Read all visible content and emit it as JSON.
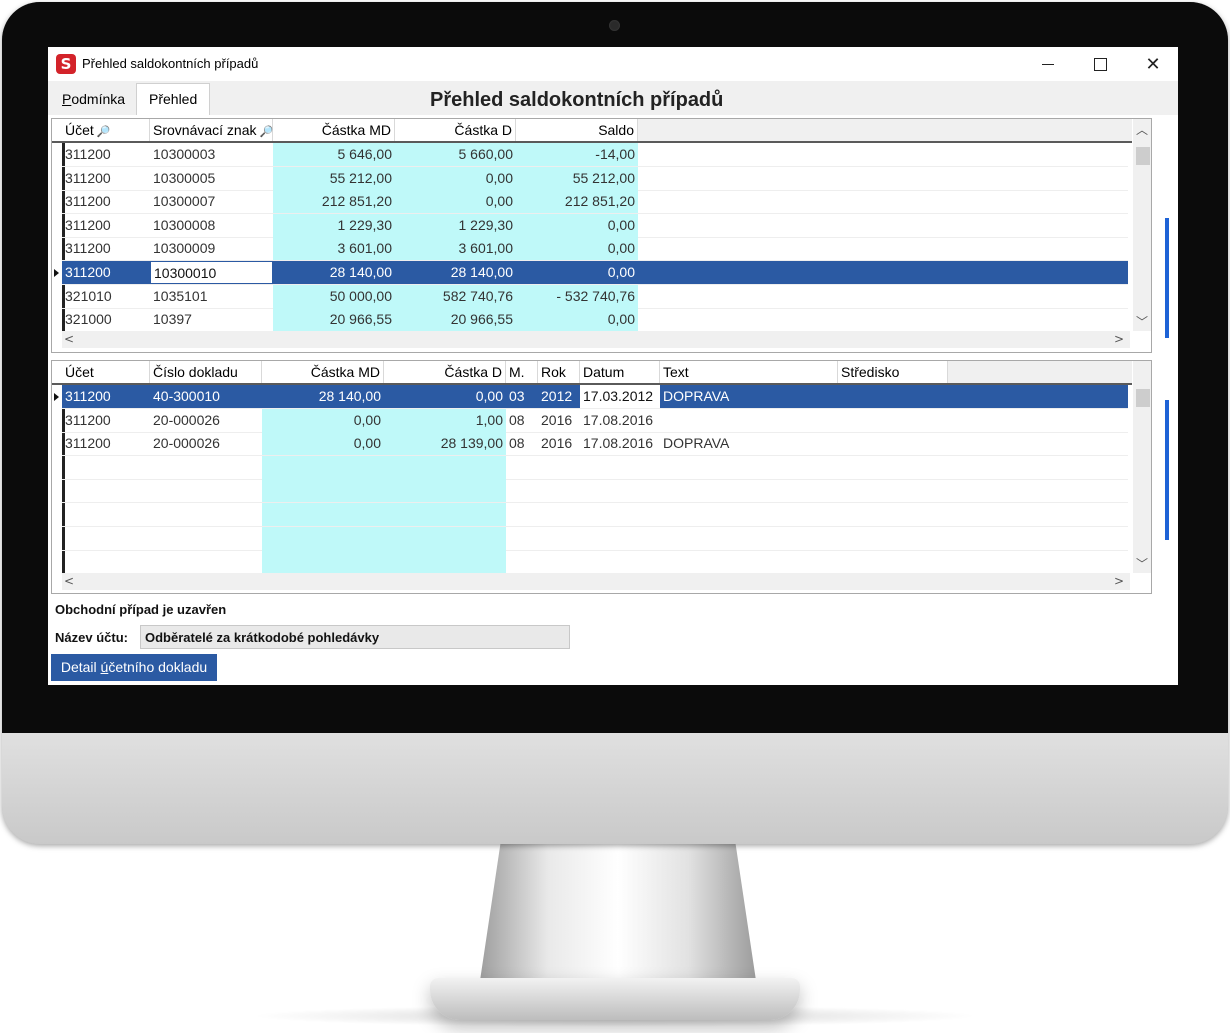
{
  "window": {
    "title": "Přehled saldokontních případů"
  },
  "tabs": [
    {
      "label": "Podmínka"
    },
    {
      "label": "Přehled"
    }
  ],
  "heading": "Přehled saldokontních případů",
  "top_grid": {
    "columns": [
      "Účet",
      "Srovnávací znak",
      "Částka MD",
      "Částka D",
      "Saldo"
    ],
    "rows": [
      [
        "311200",
        "10300003",
        "5 646,00",
        "5 660,00",
        "-14,00"
      ],
      [
        "311200",
        "10300005",
        "55 212,00",
        "0,00",
        "55 212,00"
      ],
      [
        "311200",
        "10300007",
        "212 851,20",
        "0,00",
        "212 851,20"
      ],
      [
        "311200",
        "10300008",
        "1 229,30",
        "1 229,30",
        "0,00"
      ],
      [
        "311200",
        "10300009",
        "3 601,00",
        "3 601,00",
        "0,00"
      ],
      [
        "311200",
        "10300010",
        "28 140,00",
        "28 140,00",
        "0,00"
      ],
      [
        "321010",
        "1035101",
        "50 000,00",
        "582 740,76",
        "- 532 740,76"
      ],
      [
        "321000",
        "10397",
        "20 966,55",
        "20 966,55",
        "0,00"
      ]
    ],
    "selected_row": 5
  },
  "bottom_grid": {
    "columns": [
      "Účet",
      "Číslo dokladu",
      "Částka MD",
      "Částka D",
      "M.",
      "Rok",
      "Datum",
      "Text",
      "Středisko"
    ],
    "rows": [
      [
        "311200",
        "40-300010",
        "28 140,00",
        "0,00",
        "03",
        "2012",
        "17.03.2012",
        "DOPRAVA",
        ""
      ],
      [
        "311200",
        "20-000026",
        "0,00",
        "1,00",
        "08",
        "2016",
        "17.08.2016",
        "",
        ""
      ],
      [
        "311200",
        "20-000026",
        "0,00",
        "28 139,00",
        "08",
        "2016",
        "17.08.2016",
        "DOPRAVA",
        ""
      ]
    ],
    "selected_row": 0
  },
  "status": "Obchodní případ je uzavřen",
  "account_name": {
    "label": "Název účtu:",
    "value": "Odběratelé za krátkodobé pohledávky"
  },
  "detail_button": {
    "label": "Detail účetního dokladu"
  },
  "colors": {
    "selection": "#2b5aa3",
    "amount_column": "#bff9f9"
  }
}
